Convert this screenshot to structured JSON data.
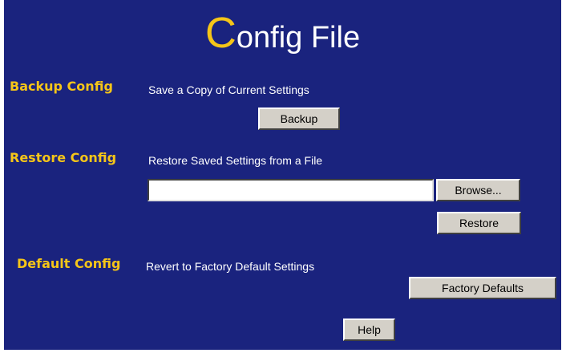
{
  "page": {
    "title_initial": "C",
    "title_rest": "onfig File"
  },
  "backup": {
    "label": "Backup Config",
    "description": "Save a Copy of Current Settings",
    "button": "Backup"
  },
  "restore": {
    "label": "Restore Config",
    "description": "Restore Saved Settings from a File",
    "file_value": "",
    "browse_button": "Browse...",
    "restore_button": "Restore"
  },
  "default": {
    "label": "Default Config",
    "description": "Revert to Factory Default Settings",
    "button": "Factory Defaults"
  },
  "help": {
    "button": "Help"
  },
  "colors": {
    "background": "#1a237e",
    "accent": "#f5c518",
    "text": "#ffffff",
    "button_face": "#d4d0c8"
  }
}
